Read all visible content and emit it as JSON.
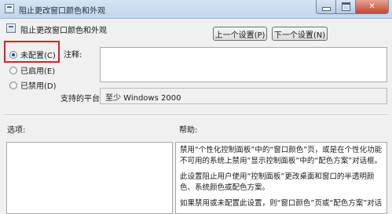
{
  "window": {
    "title": "阻止更改窗口颜色和外观",
    "subtitle": "阻止更改窗口颜色和外观"
  },
  "nav": {
    "prev_label": "上一个设置(P)",
    "next_label": "下一个设置(N)"
  },
  "state": {
    "options": [
      {
        "label": "未配置(C)",
        "checked": true
      },
      {
        "label": "已启用(E)",
        "checked": false
      },
      {
        "label": "已禁用(D)",
        "checked": false
      }
    ]
  },
  "comment": {
    "label": "注释:",
    "value": ""
  },
  "platform": {
    "label": "支持的平台:",
    "value": "至少 Windows 2000"
  },
  "sections": {
    "options_label": "选项:",
    "help_label": "帮助:"
  },
  "help": {
    "paragraphs": [
      "禁用“个性化控制面板”中的“窗口颜色”页，或是在个性化功能不可用的系统上禁用“显示控制面板”中的“配色方案”对话框。",
      "此设置阻止用户使用“控制面板”更改桌面和窗口的半透明颜色、系统颜色或配色方案。",
      "如果禁用或未配置此设置，则“窗口颜色”页或“配色方案”对话"
    ]
  },
  "colors": {
    "highlight": "#d42424",
    "radio_dot": "#1d4f8c"
  }
}
